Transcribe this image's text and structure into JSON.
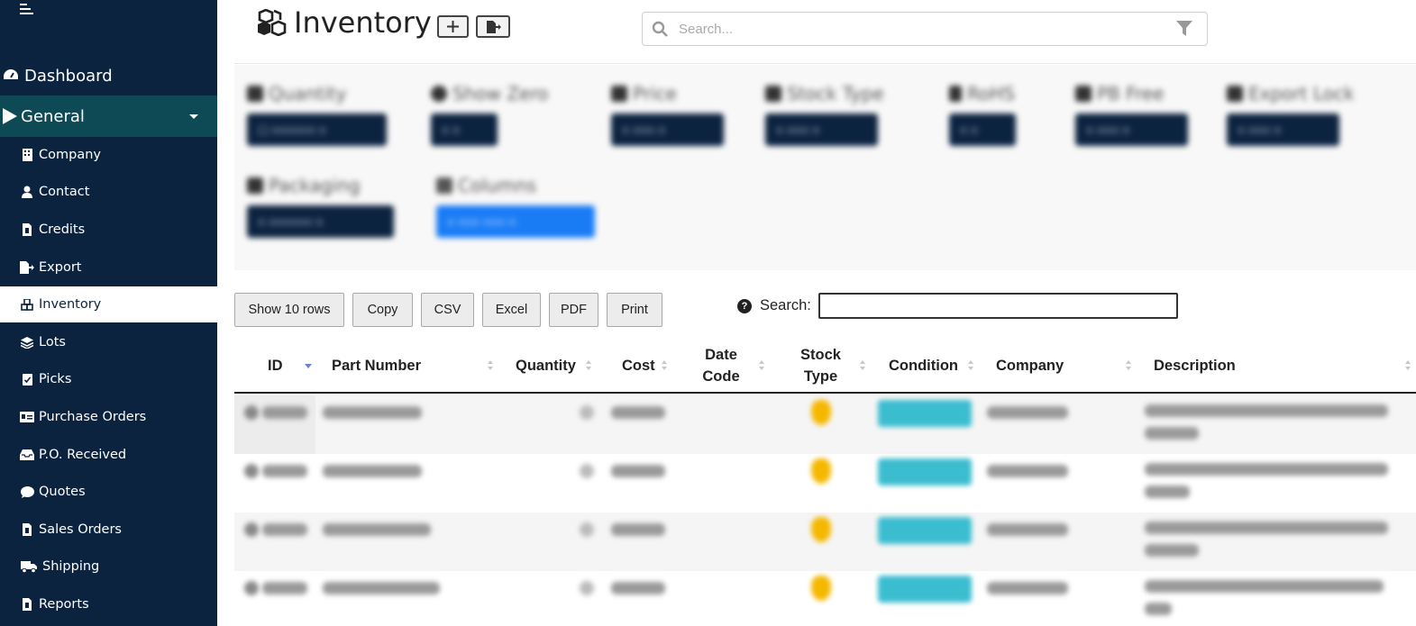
{
  "sidebar": {
    "top_item": {
      "label": "Dashboard",
      "icon": "dashboard-gauge-icon"
    },
    "group": {
      "label": "General",
      "icon": "play-triangle-icon"
    },
    "items": [
      {
        "label": "Company",
        "icon": "building-icon"
      },
      {
        "label": "Contact",
        "icon": "user-icon"
      },
      {
        "label": "Credits",
        "icon": "file-invoice-icon"
      },
      {
        "label": "Export",
        "icon": "file-export-icon"
      },
      {
        "label": "Inventory",
        "icon": "cubes-icon",
        "active": true
      },
      {
        "label": "Lots",
        "icon": "layer-group-icon"
      },
      {
        "label": "Picks",
        "icon": "clipboard-check-icon"
      },
      {
        "label": "Purchase Orders",
        "icon": "money-check-icon"
      },
      {
        "label": "P.O. Received",
        "icon": "inbox-icon"
      },
      {
        "label": "Quotes",
        "icon": "comment-icon"
      },
      {
        "label": "Sales Orders",
        "icon": "file-invoice-dollar-icon"
      },
      {
        "label": "Shipping",
        "icon": "truck-icon"
      },
      {
        "label": "Reports",
        "icon": "file-report-icon"
      }
    ]
  },
  "header": {
    "title": "Inventory",
    "search_placeholder": "Search..."
  },
  "table_tools": {
    "buttons": [
      "Show 10 rows",
      "Copy",
      "CSV",
      "Excel",
      "PDF",
      "Print"
    ],
    "search_label": "Search:"
  },
  "table": {
    "columns": [
      "ID",
      "Part Number",
      "Quantity",
      "Cost",
      "Date Code",
      "Stock Type",
      "Condition",
      "Company",
      "Description"
    ],
    "row_count_visible": 4
  },
  "colors": {
    "sidebar_bg": "#0c2340",
    "sidebar_active_group": "#0d4a55",
    "condition_badge": "#3bbdd0",
    "stock_icon": "#f5b800",
    "filter_button": "#0c2340",
    "filter_button_active": "#1a7cf5"
  }
}
